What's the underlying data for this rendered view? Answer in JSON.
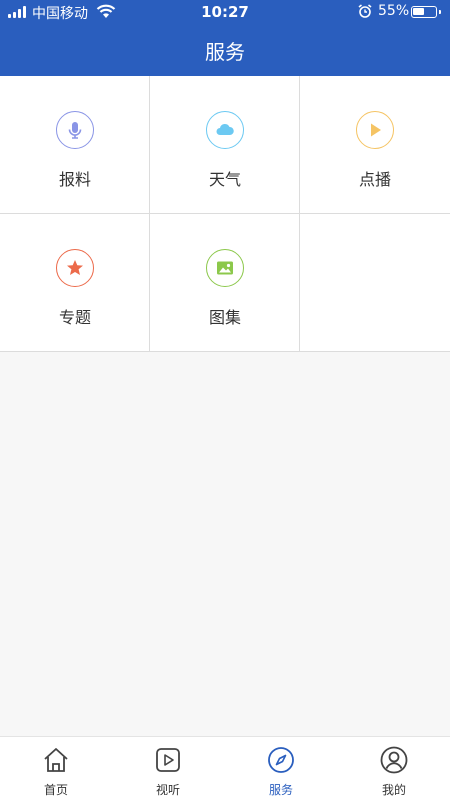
{
  "status_bar": {
    "carrier": "中国移动",
    "time": "10:27",
    "battery_percent": "55%",
    "battery_level": 0.55
  },
  "header": {
    "title": "服务"
  },
  "services": [
    {
      "label": "报料",
      "icon": "microphone-icon",
      "color": "#8a95e6"
    },
    {
      "label": "天气",
      "icon": "cloud-icon",
      "color": "#6cc9f2"
    },
    {
      "label": "点播",
      "icon": "play-icon",
      "color": "#f5c464"
    },
    {
      "label": "专题",
      "icon": "star-icon",
      "color": "#ec6a4a"
    },
    {
      "label": "图集",
      "icon": "image-icon",
      "color": "#8cc84b"
    }
  ],
  "tabbar": {
    "active_color": "#2a5ebe",
    "items": [
      {
        "label": "首页",
        "icon": "home-icon",
        "active": false
      },
      {
        "label": "视听",
        "icon": "video-play-icon",
        "active": false
      },
      {
        "label": "服务",
        "icon": "compass-icon",
        "active": true
      },
      {
        "label": "我的",
        "icon": "user-icon",
        "active": false
      }
    ]
  }
}
